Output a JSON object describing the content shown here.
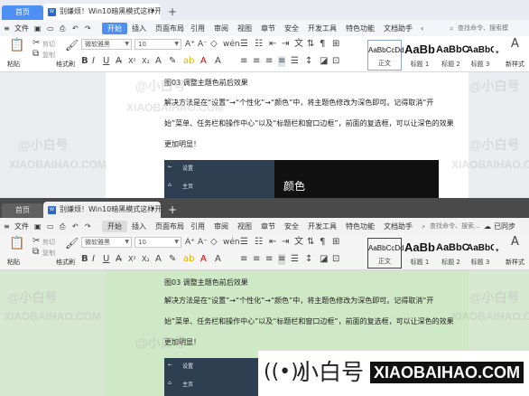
{
  "tabs": {
    "home_label": "首页",
    "doc_label": "别嫌烦！Win10暗黑模式这样开",
    "doc_icon": "W",
    "tab_dot": "•",
    "new_tab": "+"
  },
  "menu": {
    "items": [
      "文件",
      "开始",
      "插入",
      "页面布局",
      "引用",
      "审阅",
      "视图",
      "章节",
      "安全",
      "开发工具",
      "特色功能",
      "文档助手"
    ],
    "search_placeholder": "查找命令、搜索模板",
    "search_placeholder_bottom": "查找命令、搜索...",
    "share_label": "已同步"
  },
  "ribbon": {
    "paste_label": "粘贴",
    "cut_label": "剪切",
    "copy_label": "复制",
    "format_painter_label": "格式刷",
    "font_name": "微软雅黑",
    "font_size": "10",
    "new_style_label": "新样式",
    "styles": [
      {
        "preview": "AaBbCcDd",
        "name": "正文"
      },
      {
        "preview": "AaBb",
        "name": "标题 1"
      },
      {
        "preview": "AaBbC",
        "name": "标题 2"
      },
      {
        "preview": "AaBbC",
        "name": "标题 3"
      }
    ]
  },
  "document": {
    "caption": "图03 调整主题色前后效果",
    "para_line1": "解决方法是在“设置”→“个性化”→“颜色”中，将主题色修改为深色即可。记得取消“开",
    "para_line2": "始”菜单、任务栏和操作中心”以及“标题栏和窗口边框”，前面的复选框，可以让深色的效果",
    "para_line3": "更加明显！",
    "settings_title": "设置",
    "settings_home": "主页",
    "settings_color_heading": "颜色"
  },
  "watermark": {
    "brand_cn": "@小白号",
    "brand_url": "XIAOBAIHAO.COM"
  },
  "brand": {
    "logo_name": "小白号",
    "url": "XIAOBAIHAO.COM"
  }
}
